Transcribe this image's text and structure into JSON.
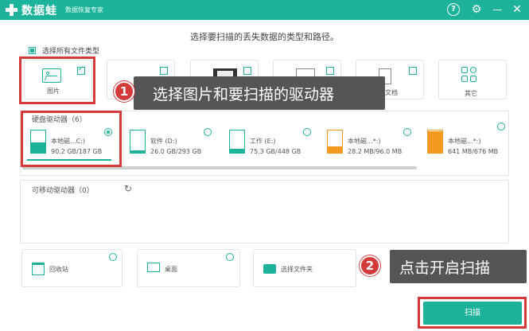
{
  "app": {
    "name": "数据蛙",
    "subtitle": "数据恢复专家",
    "help_glyph": "?",
    "settings_glyph": "⚙",
    "minimize_glyph": "—",
    "close_glyph": "✕"
  },
  "heading": "选择要扫描的丢失数据的类型和路径。",
  "select_all": {
    "label": "选择所有文件类型",
    "checked": true
  },
  "file_types": [
    {
      "label": "图片",
      "icon": "image-icon",
      "checked": true
    },
    {
      "label": "",
      "icon": "audio-icon",
      "checked": false
    },
    {
      "label": "",
      "icon": "video-icon",
      "checked": false
    },
    {
      "label": "",
      "icon": "email-icon",
      "checked": false
    },
    {
      "label": "文档",
      "icon": "document-icon",
      "checked": false
    },
    {
      "label": "其它",
      "icon": "other-icon",
      "checked": false
    }
  ],
  "hard_drives": {
    "title": "硬盘驱动器（6）",
    "drives": [
      {
        "name": "本地磁...C:)",
        "size": "90.2 GB/187 GB",
        "selected": true,
        "usage": 0.48,
        "color": "#1db39b"
      },
      {
        "name": "软件 (D:)",
        "size": "26.0 GB/293 GB",
        "selected": false,
        "usage": 0.09,
        "color": "#1db39b"
      },
      {
        "name": "工作 (E:)",
        "size": "75.3 GB/448 GB",
        "selected": false,
        "usage": 0.17,
        "color": "#1db39b"
      },
      {
        "name": "本地磁...*:)",
        "size": "28.2 MB/96.0 MB",
        "selected": false,
        "usage": 0.29,
        "color": "#f39a1e"
      },
      {
        "name": "本地磁...*:)",
        "size": "641 MB/676 MB",
        "selected": false,
        "usage": 0.95,
        "color": "#f39a1e"
      }
    ]
  },
  "removable": {
    "title": "可移动驱动器（0）",
    "refresh_glyph": "↻"
  },
  "locations": [
    {
      "label": "回收站",
      "icon": "recycle-bin-icon"
    },
    {
      "label": "桌面",
      "icon": "desktop-icon"
    },
    {
      "label": "选择文件夹",
      "icon": "folder-icon"
    }
  ],
  "callouts": [
    {
      "number": "1",
      "text": "选择图片和要扫描的驱动器"
    },
    {
      "number": "2",
      "text": "点击开启扫描"
    }
  ],
  "scan_button": "扫描",
  "colors": {
    "accent": "#1db39b",
    "highlight": "#d33a3a",
    "callout_bg": "#555555"
  }
}
